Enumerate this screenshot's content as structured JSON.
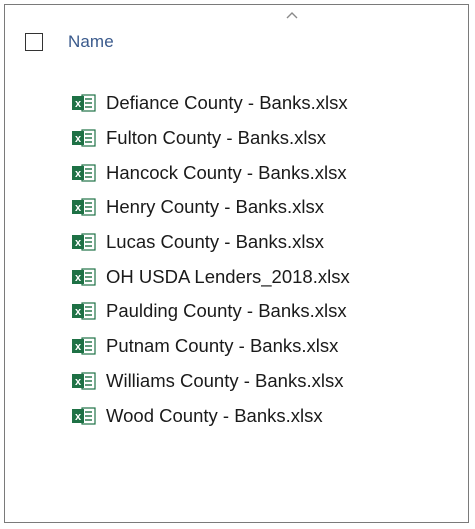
{
  "header": {
    "name_column_label": "Name",
    "select_all_checkbox_icon": "checkbox-icon",
    "sort_indicator_icon": "sort-ascending-icon"
  },
  "files": [
    {
      "name": "Defiance County - Banks.xlsx",
      "icon": "excel-file-icon"
    },
    {
      "name": "Fulton County - Banks.xlsx",
      "icon": "excel-file-icon"
    },
    {
      "name": "Hancock County - Banks.xlsx",
      "icon": "excel-file-icon"
    },
    {
      "name": "Henry County - Banks.xlsx",
      "icon": "excel-file-icon"
    },
    {
      "name": "Lucas County - Banks.xlsx",
      "icon": "excel-file-icon"
    },
    {
      "name": "OH USDA Lenders_2018.xlsx",
      "icon": "excel-file-icon"
    },
    {
      "name": "Paulding County - Banks.xlsx",
      "icon": "excel-file-icon"
    },
    {
      "name": "Putnam County - Banks.xlsx",
      "icon": "excel-file-icon"
    },
    {
      "name": "Williams County - Banks.xlsx",
      "icon": "excel-file-icon"
    },
    {
      "name": "Wood County - Banks.xlsx",
      "icon": "excel-file-icon"
    }
  ],
  "colors": {
    "header_text": "#3a5a8c",
    "excel_green": "#1e7145",
    "frame_border": "#7a7a7a"
  }
}
